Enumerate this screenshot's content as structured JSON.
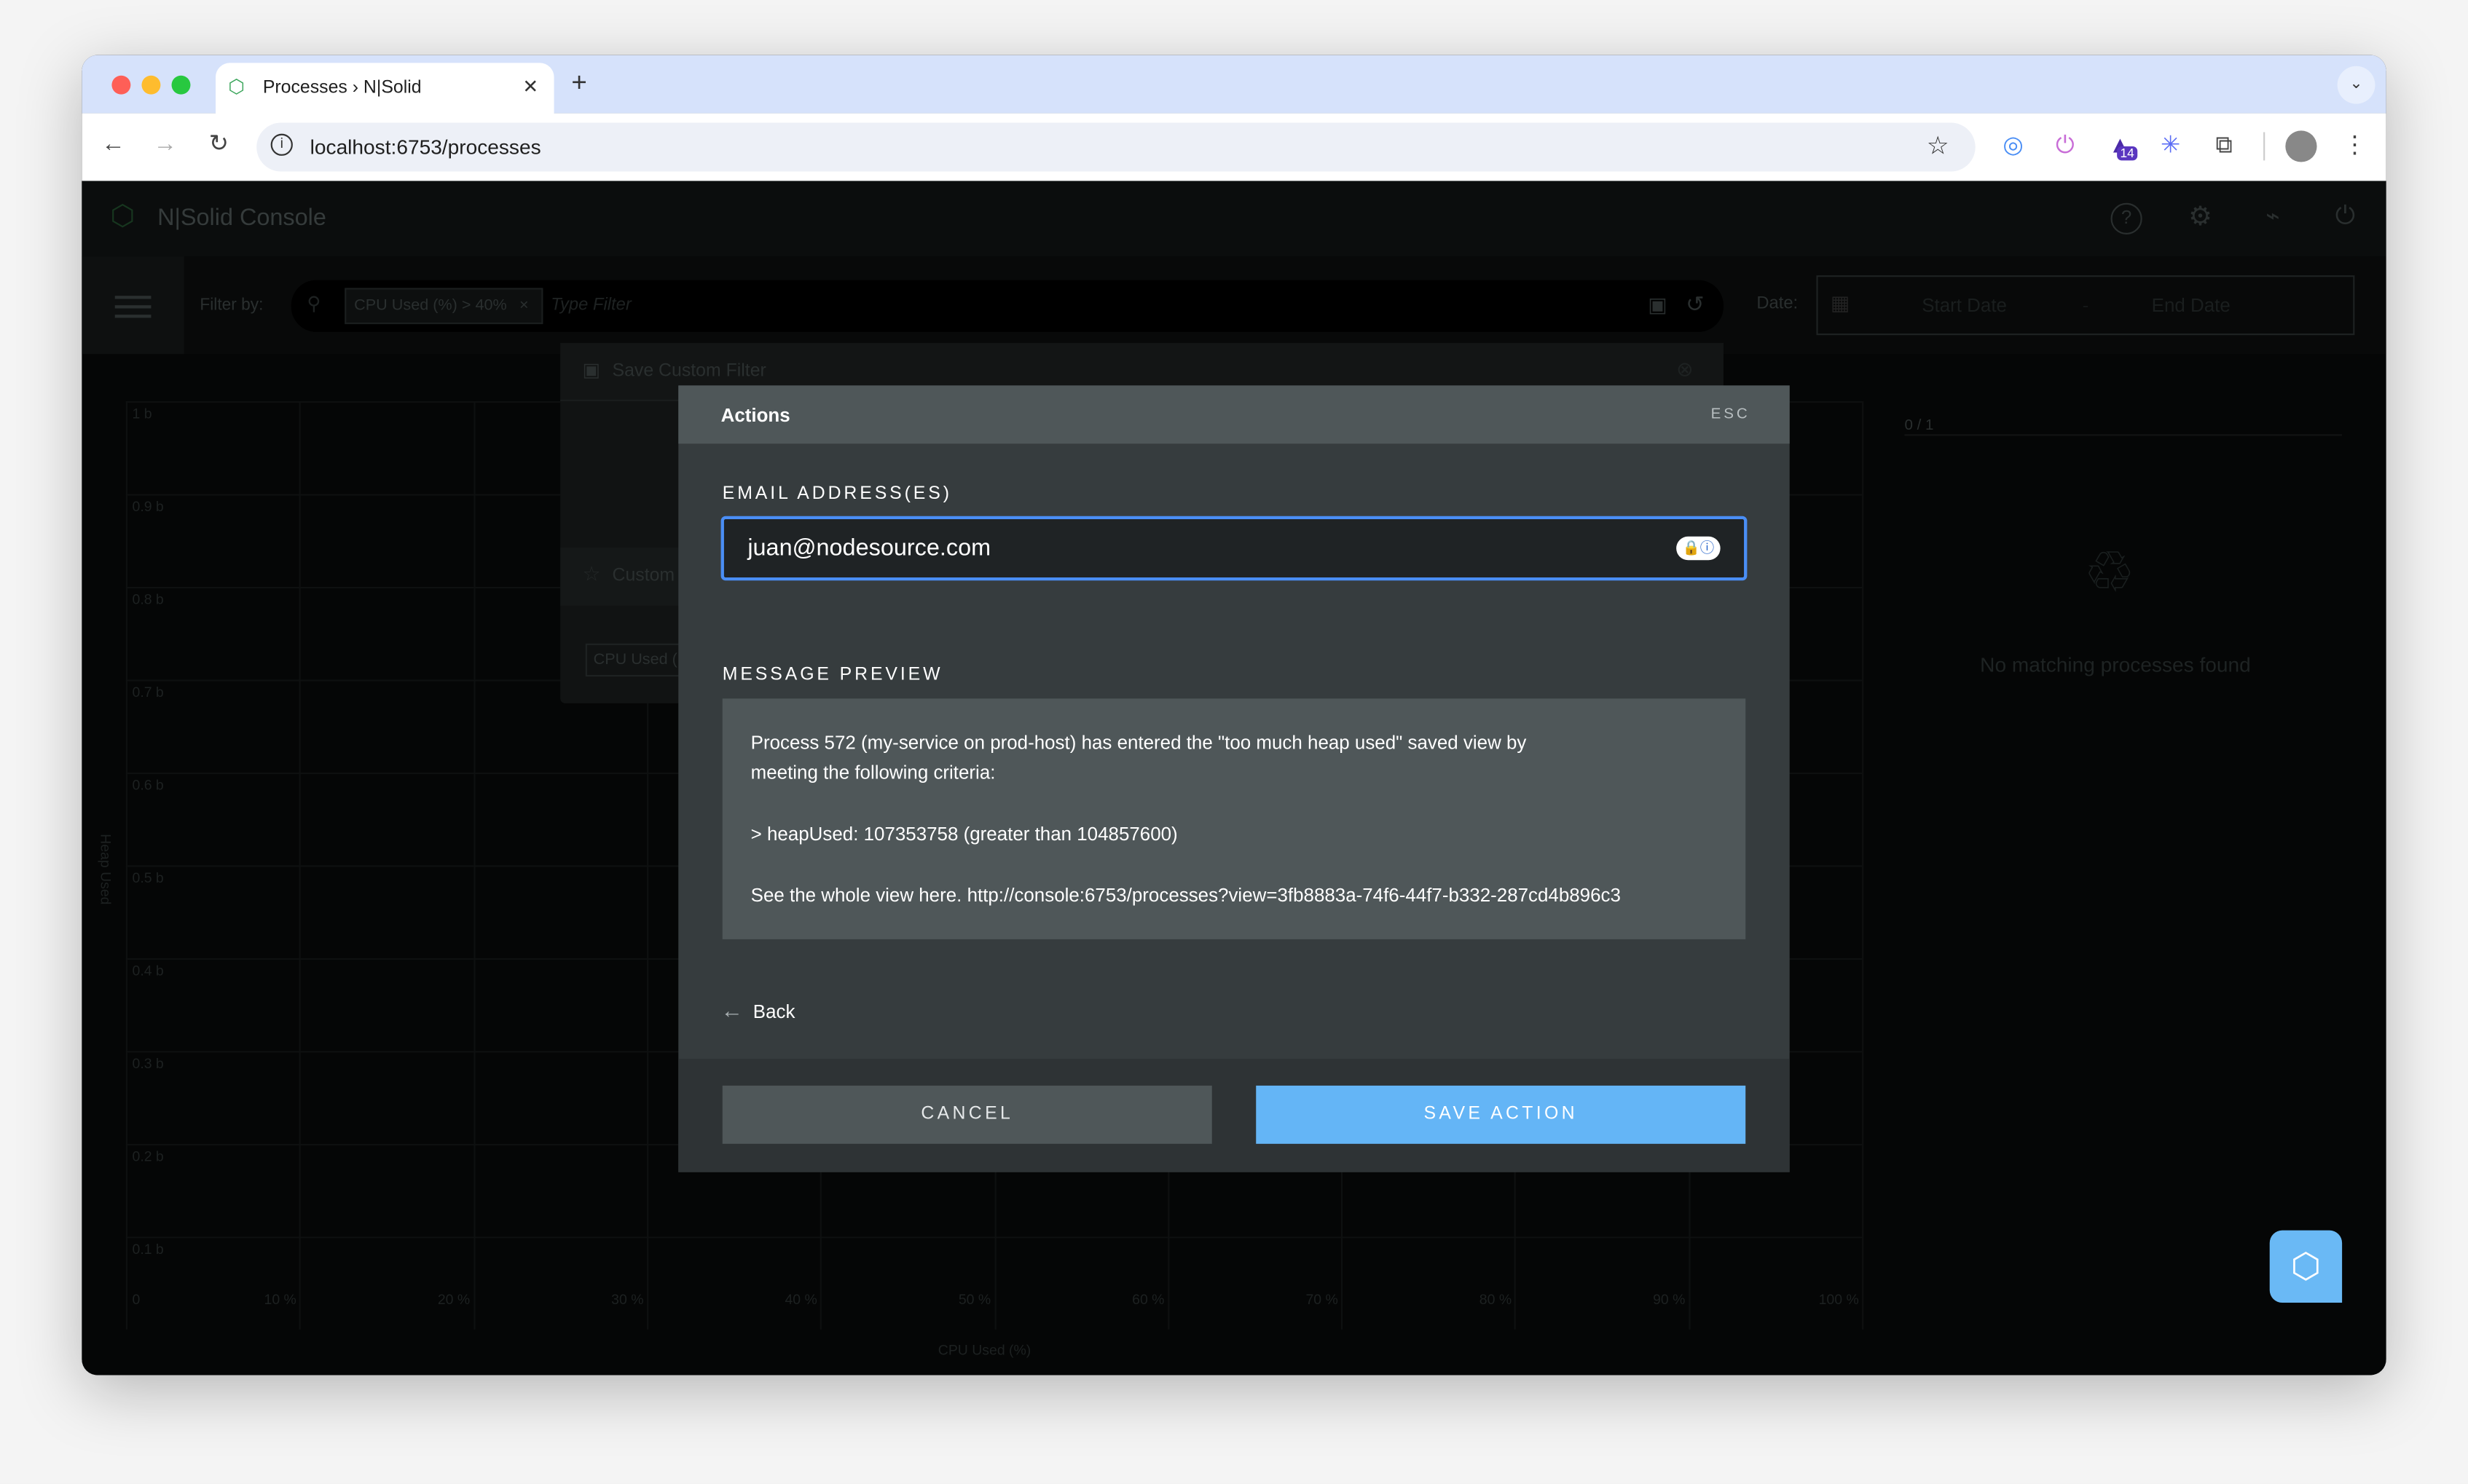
{
  "browser": {
    "tab_title": "Processes › N|Solid",
    "url": "localhost:6753/processes",
    "extension_badge": "14"
  },
  "app": {
    "title": "N|Solid Console",
    "header_icons": [
      "help-icon",
      "gear-icon",
      "plug-icon",
      "power-icon"
    ],
    "filter": {
      "label": "Filter by:",
      "chip": "CPU Used (%) > 40%",
      "placeholder": "Type Filter",
      "date_label": "Date:",
      "start_placeholder": "Start Date",
      "date_separator": "-",
      "end_placeholder": "End Date"
    },
    "chart": {
      "y_axis_label": "Heap Used",
      "x_axis_label": "CPU Used (%)",
      "y_ticks": [
        "1 b",
        "0.9 b",
        "0.8 b",
        "0.7 b",
        "0.6 b",
        "0.5 b",
        "0.4 b",
        "0.3 b",
        "0.2 b",
        "0.1 b"
      ],
      "x_ticks": [
        "0",
        "10 %",
        "20 %",
        "30 %",
        "40 %",
        "50 %",
        "60 %",
        "70 %",
        "80 %",
        "90 %",
        "100 %"
      ]
    },
    "process_list": {
      "count": "0 / 1",
      "empty_message": "No matching processes found"
    },
    "popover": {
      "title": "Save Custom Filter",
      "section_title": "Custom",
      "chip": "CPU Used ("
    }
  },
  "modal": {
    "title": "Actions",
    "esc_label": "ESC",
    "email_label": "EMAIL ADDRESS(ES)",
    "email_value": "juan@nodesource.com",
    "preview_label": "MESSAGE PREVIEW",
    "preview_lines": [
      "Process 572 (my-service on prod-host) has entered the \"too much heap used\" saved view by",
      "meeting the following criteria:",
      "> heapUsed: 107353758 (greater than 104857600)",
      "See the whole view here. http://console:6753/processes?view=3fb8883a-74f6-44f7-b332-287cd4b896c3"
    ],
    "back_label": "Back",
    "cancel_label": "CANCEL",
    "save_label": "SAVE ACTION",
    "colors": {
      "accent": "#64b5f6",
      "focus_border": "#4a8ef5",
      "header": "#4f5759",
      "body": "#363c3e"
    }
  }
}
